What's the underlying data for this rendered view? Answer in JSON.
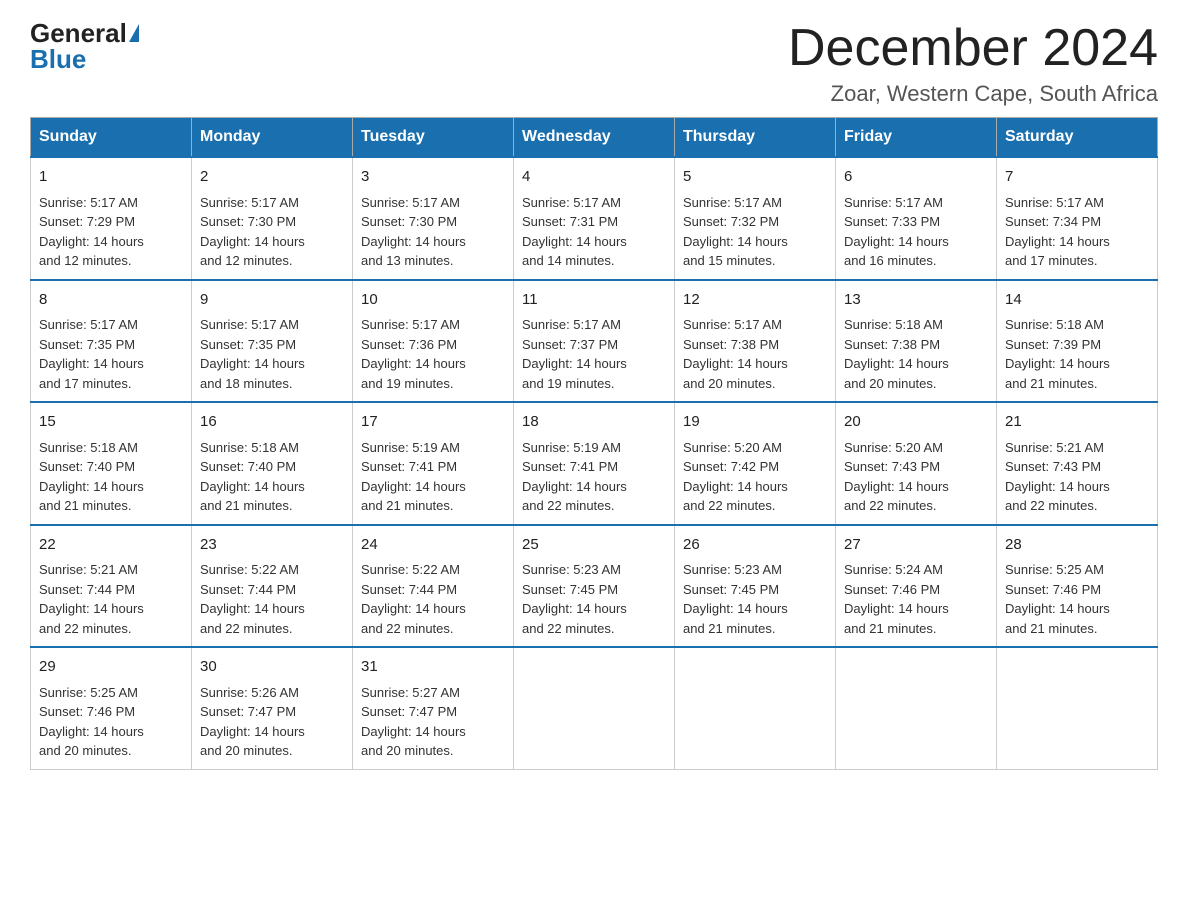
{
  "header": {
    "logo_general": "General",
    "logo_blue": "Blue",
    "month_title": "December 2024",
    "location": "Zoar, Western Cape, South Africa"
  },
  "days_of_week": [
    "Sunday",
    "Monday",
    "Tuesday",
    "Wednesday",
    "Thursday",
    "Friday",
    "Saturday"
  ],
  "weeks": [
    [
      {
        "day": "1",
        "sunrise": "5:17 AM",
        "sunset": "7:29 PM",
        "daylight": "14 hours and 12 minutes."
      },
      {
        "day": "2",
        "sunrise": "5:17 AM",
        "sunset": "7:30 PM",
        "daylight": "14 hours and 12 minutes."
      },
      {
        "day": "3",
        "sunrise": "5:17 AM",
        "sunset": "7:30 PM",
        "daylight": "14 hours and 13 minutes."
      },
      {
        "day": "4",
        "sunrise": "5:17 AM",
        "sunset": "7:31 PM",
        "daylight": "14 hours and 14 minutes."
      },
      {
        "day": "5",
        "sunrise": "5:17 AM",
        "sunset": "7:32 PM",
        "daylight": "14 hours and 15 minutes."
      },
      {
        "day": "6",
        "sunrise": "5:17 AM",
        "sunset": "7:33 PM",
        "daylight": "14 hours and 16 minutes."
      },
      {
        "day": "7",
        "sunrise": "5:17 AM",
        "sunset": "7:34 PM",
        "daylight": "14 hours and 17 minutes."
      }
    ],
    [
      {
        "day": "8",
        "sunrise": "5:17 AM",
        "sunset": "7:35 PM",
        "daylight": "14 hours and 17 minutes."
      },
      {
        "day": "9",
        "sunrise": "5:17 AM",
        "sunset": "7:35 PM",
        "daylight": "14 hours and 18 minutes."
      },
      {
        "day": "10",
        "sunrise": "5:17 AM",
        "sunset": "7:36 PM",
        "daylight": "14 hours and 19 minutes."
      },
      {
        "day": "11",
        "sunrise": "5:17 AM",
        "sunset": "7:37 PM",
        "daylight": "14 hours and 19 minutes."
      },
      {
        "day": "12",
        "sunrise": "5:17 AM",
        "sunset": "7:38 PM",
        "daylight": "14 hours and 20 minutes."
      },
      {
        "day": "13",
        "sunrise": "5:18 AM",
        "sunset": "7:38 PM",
        "daylight": "14 hours and 20 minutes."
      },
      {
        "day": "14",
        "sunrise": "5:18 AM",
        "sunset": "7:39 PM",
        "daylight": "14 hours and 21 minutes."
      }
    ],
    [
      {
        "day": "15",
        "sunrise": "5:18 AM",
        "sunset": "7:40 PM",
        "daylight": "14 hours and 21 minutes."
      },
      {
        "day": "16",
        "sunrise": "5:18 AM",
        "sunset": "7:40 PM",
        "daylight": "14 hours and 21 minutes."
      },
      {
        "day": "17",
        "sunrise": "5:19 AM",
        "sunset": "7:41 PM",
        "daylight": "14 hours and 21 minutes."
      },
      {
        "day": "18",
        "sunrise": "5:19 AM",
        "sunset": "7:41 PM",
        "daylight": "14 hours and 22 minutes."
      },
      {
        "day": "19",
        "sunrise": "5:20 AM",
        "sunset": "7:42 PM",
        "daylight": "14 hours and 22 minutes."
      },
      {
        "day": "20",
        "sunrise": "5:20 AM",
        "sunset": "7:43 PM",
        "daylight": "14 hours and 22 minutes."
      },
      {
        "day": "21",
        "sunrise": "5:21 AM",
        "sunset": "7:43 PM",
        "daylight": "14 hours and 22 minutes."
      }
    ],
    [
      {
        "day": "22",
        "sunrise": "5:21 AM",
        "sunset": "7:44 PM",
        "daylight": "14 hours and 22 minutes."
      },
      {
        "day": "23",
        "sunrise": "5:22 AM",
        "sunset": "7:44 PM",
        "daylight": "14 hours and 22 minutes."
      },
      {
        "day": "24",
        "sunrise": "5:22 AM",
        "sunset": "7:44 PM",
        "daylight": "14 hours and 22 minutes."
      },
      {
        "day": "25",
        "sunrise": "5:23 AM",
        "sunset": "7:45 PM",
        "daylight": "14 hours and 22 minutes."
      },
      {
        "day": "26",
        "sunrise": "5:23 AM",
        "sunset": "7:45 PM",
        "daylight": "14 hours and 21 minutes."
      },
      {
        "day": "27",
        "sunrise": "5:24 AM",
        "sunset": "7:46 PM",
        "daylight": "14 hours and 21 minutes."
      },
      {
        "day": "28",
        "sunrise": "5:25 AM",
        "sunset": "7:46 PM",
        "daylight": "14 hours and 21 minutes."
      }
    ],
    [
      {
        "day": "29",
        "sunrise": "5:25 AM",
        "sunset": "7:46 PM",
        "daylight": "14 hours and 20 minutes."
      },
      {
        "day": "30",
        "sunrise": "5:26 AM",
        "sunset": "7:47 PM",
        "daylight": "14 hours and 20 minutes."
      },
      {
        "day": "31",
        "sunrise": "5:27 AM",
        "sunset": "7:47 PM",
        "daylight": "14 hours and 20 minutes."
      },
      null,
      null,
      null,
      null
    ]
  ],
  "labels": {
    "sunrise": "Sunrise:",
    "sunset": "Sunset:",
    "daylight": "Daylight:"
  }
}
